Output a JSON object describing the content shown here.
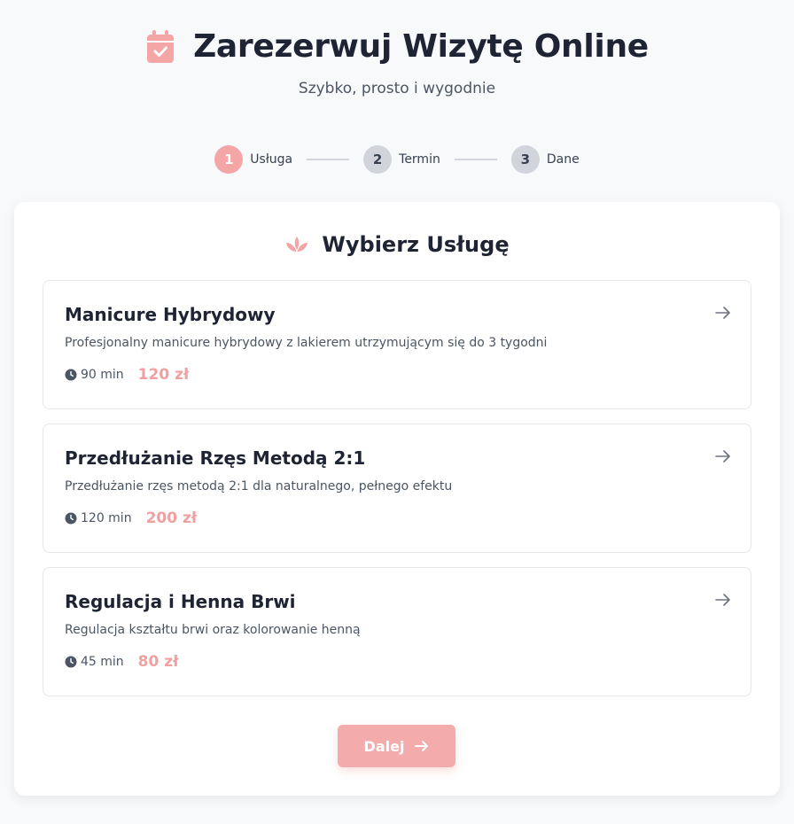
{
  "header": {
    "title": "Zarezerwuj Wizytę Online",
    "subtitle": "Szybko, prosto i wygodnie",
    "icon": "calendar-check-icon"
  },
  "steps": [
    {
      "number": "1",
      "label": "Usługa",
      "active": true
    },
    {
      "number": "2",
      "label": "Termin",
      "active": false
    },
    {
      "number": "3",
      "label": "Dane",
      "active": false
    }
  ],
  "card": {
    "title": "Wybierz Usługę",
    "icon": "lotus-icon"
  },
  "services": [
    {
      "name": "Manicure Hybrydowy",
      "description": "Profesjonalny manicure hybrydowy z lakierem utrzymującym się do 3 tygodni",
      "duration": "90 min",
      "price": "120 zł"
    },
    {
      "name": "Przedłużanie Rzęs Metodą 2:1",
      "description": "Przedłużanie rzęs metodą 2:1 dla naturalnego, pełnego efektu",
      "duration": "120 min",
      "price": "200 zł"
    },
    {
      "name": "Regulacja i Henna Brwi",
      "description": "Regulacja kształtu brwi oraz kolorowanie henną",
      "duration": "45 min",
      "price": "80 zł"
    }
  ],
  "next_button": {
    "label": "Dalej"
  },
  "colors": {
    "accent": "#f4a5a5",
    "background": "#f8f9fb",
    "title": "#1e2433",
    "inactive_step": "#d1d5db"
  }
}
